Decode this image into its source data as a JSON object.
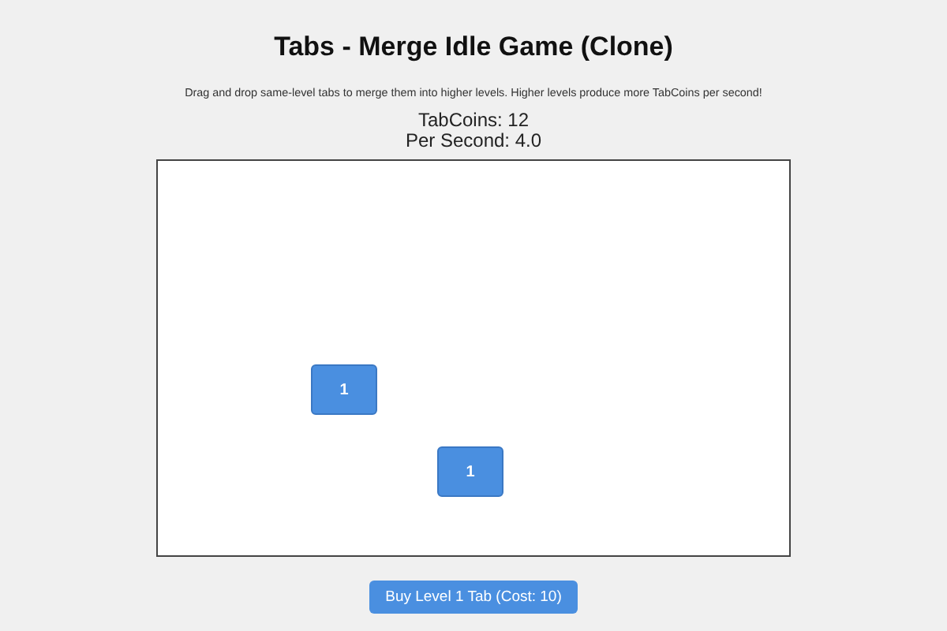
{
  "title": "Tabs - Merge Idle Game (Clone)",
  "instructions": "Drag and drop same-level tabs to merge them into higher levels. Higher levels produce more TabCoins per second!",
  "coins": "TabCoins: 12",
  "per_second": "Per Second: 4.0",
  "tabs": [
    {
      "label": "1"
    },
    {
      "label": "1"
    }
  ],
  "buy_button": "Buy Level 1 Tab (Cost: 10)"
}
